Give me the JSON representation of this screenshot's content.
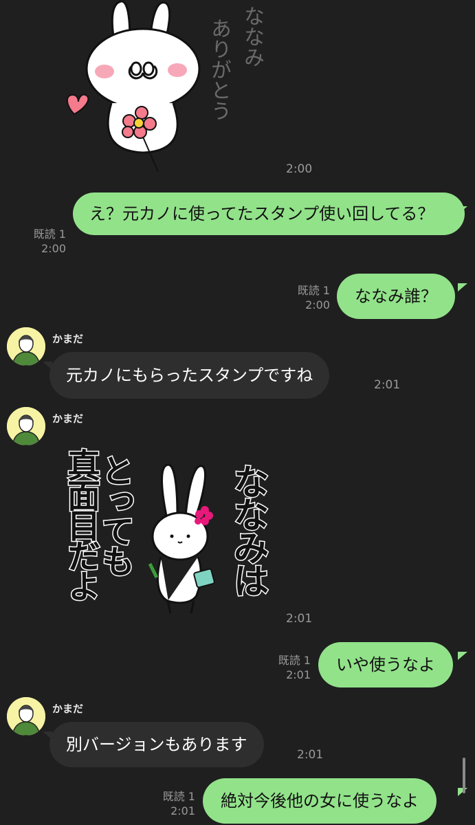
{
  "messages": [
    {
      "type": "sticker-in",
      "sticker_name": "usagi-arigatou-sticker",
      "sticker_text": [
        "ななみ",
        "ありがとう"
      ],
      "time": "2:00"
    },
    {
      "type": "text-out",
      "text": "え？元カノに使ってたスタンプ使い回してる？",
      "read": "既読 1",
      "time": "2:00"
    },
    {
      "type": "text-out",
      "text": "ななみ誰？",
      "read": "既読 1",
      "time": "2:00"
    },
    {
      "type": "text-in",
      "sender": "かまだ",
      "text": "元カノにもらったスタンプですね",
      "time": "2:01"
    },
    {
      "type": "sticker-in",
      "sender": "かまだ",
      "sticker_name": "usagi-nanami-majime-sticker",
      "sticker_text": [
        "ななみは",
        "とっても",
        "真面目だよ"
      ],
      "time": "2:01"
    },
    {
      "type": "text-out",
      "text": "いや使うなよ",
      "read": "既読 1",
      "time": "2:01"
    },
    {
      "type": "text-in",
      "sender": "かまだ",
      "text": "別バージョンもあります",
      "time": "2:01"
    },
    {
      "type": "text-out",
      "text": "絶対今後他の女に使うなよ",
      "read": "既読 1",
      "time": "2:01"
    }
  ],
  "colors": {
    "background": "#1f1f1f",
    "outgoing_bubble": "#92e28a",
    "incoming_bubble": "#2e2e2e",
    "meta_text": "#9a9a9a",
    "avatar_bg": "#f6f3a4"
  }
}
